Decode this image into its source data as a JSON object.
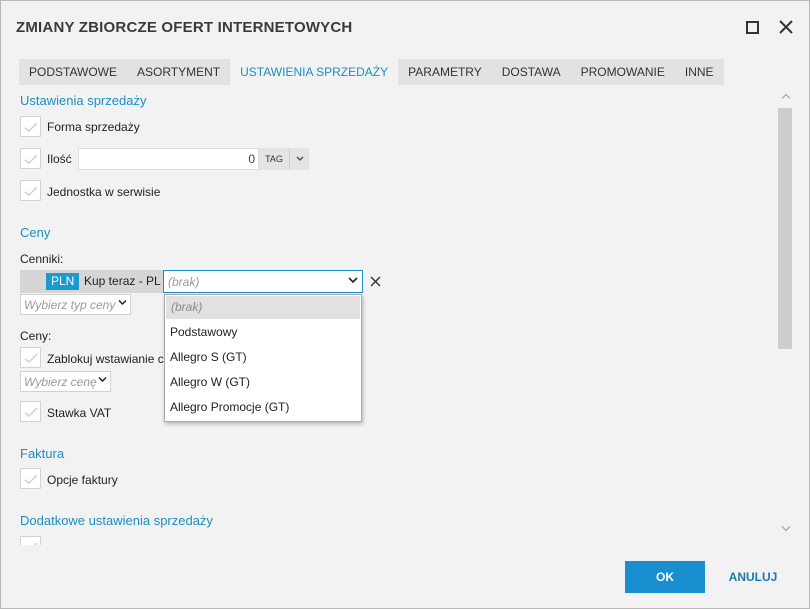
{
  "window": {
    "title": "ZMIANY ZBIORCZE OFERT INTERNETOWYCH"
  },
  "tabs": [
    {
      "label": "PODSTAWOWE"
    },
    {
      "label": "ASORTYMENT"
    },
    {
      "label": "USTAWIENIA SPRZEDAŻY",
      "active": true
    },
    {
      "label": "PARAMETRY"
    },
    {
      "label": "DOSTAWA"
    },
    {
      "label": "PROMOWANIE"
    },
    {
      "label": "INNE"
    }
  ],
  "sales_settings": {
    "section_title": "Ustawienia sprzedaży",
    "sale_form_label": "Forma sprzedaży",
    "quantity_label": "Ilość",
    "quantity_value": "0",
    "tag_label": "TAG",
    "unit_label": "Jednostka w serwisie"
  },
  "prices": {
    "section_title": "Ceny",
    "pricelists_label": "Cenniki:",
    "currency_badge": "PLN",
    "pricelist_name": "Kup teraz - PL",
    "select_placeholder": "(brak)",
    "price_type_placeholder": "Wybierz typ ceny",
    "prices_label": "Ceny:",
    "block_label": "Zablokuj wstawianie c",
    "price_select_placeholder": "Wybierz cenę",
    "vat_label": "Stawka VAT"
  },
  "dropdown": {
    "items": [
      "(brak)",
      "Podstawowy",
      "Allegro S (GT)",
      "Allegro W (GT)",
      "Allegro Promocje (GT)"
    ]
  },
  "invoice": {
    "section_title": "Faktura",
    "options_label": "Opcje faktury"
  },
  "additional": {
    "section_title": "Dodatkowe ustawienia sprzedaży"
  },
  "footer": {
    "ok_label": "OK",
    "cancel_label": "ANULUJ"
  },
  "colors": {
    "accent": "#1a8fc4",
    "ok_button": "#1a8fd0",
    "badge": "#1a9ad0"
  }
}
